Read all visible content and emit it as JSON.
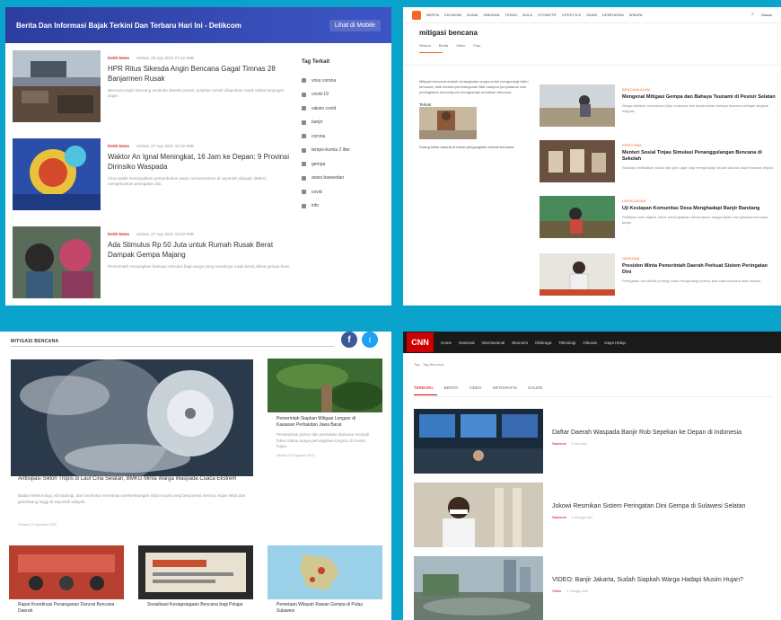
{
  "p1": {
    "header_title": "Berita Dan Informasi Bajak Terkini Dan Terbaru Hari Ini - Detikcom",
    "header_button": "Lihat di Mobile",
    "articles": [
      {
        "category": "Detik News",
        "date": "Selasa, 05 Agu 2021 07:42 WIB",
        "title": "HPR Ritus Sikesda Angin Bencana Gagal Timnas 28 Banjarmen Rusak",
        "excerpt": "Bencana angin kencang melanda daerah pesisir, puluhan rumah dilaporkan rusak akibat terjangan angin."
      },
      {
        "category": "Detik News",
        "date": "Selasa, 07 Agu 2021 10:19 WIB",
        "title": "Waktor An Ignal Meningkat, 16 Jam ke Depan: 9 Provinsi Dirinsiko Waspada",
        "excerpt": "Citra satelit menunjukkan pertumbuhan awan cumulonimbus di sejumlah wilayah, BMKG mengeluarkan peringatan dini."
      },
      {
        "category": "Detik News",
        "date": "Selasa, 07 Agu 2021 14:03 WIB",
        "title": "Ada Stimulus Rp 50 Juta untuk Rumah Rusak Berat Dampak Gempa Majang",
        "excerpt": "Pemerintah menyiapkan bantuan stimulus bagi warga yang rumahnya rusak berat akibat gempa bumi."
      }
    ],
    "side_title": "Tag Terkait",
    "tags": [
      "virus corona",
      "covid-19",
      "vaksin covid",
      "banjir",
      "corona",
      "tempo-kurnia 2 liter",
      "gempa",
      "anies baswedan",
      "covid",
      "info"
    ]
  },
  "p2": {
    "nav": [
      "BERITA",
      "EKONOMI",
      "DUNIA",
      "HIBURAN",
      "TEKNO",
      "BOLA",
      "OTOMOTIF",
      "LIFESTYLE",
      "SAINS",
      "KESEHATAN",
      "WISATA"
    ],
    "mask_label": "Masuk",
    "page_title": "mitigasi bencana",
    "subtabs": [
      "Semua",
      "Berita",
      "Video",
      "Foto"
    ],
    "intro": "Mitigasi bencana adalah serangkaian upaya untuk mengurangi risiko bencana, baik melalui pembangunan fisik maupun penyadaran dan peningkatan kemampuan menghadapi ancaman bencana.",
    "side_label": "Terkait",
    "small_text": "Ruang kelas darurat di lokasi pengungsian korban bencana",
    "articles": [
      {
        "category": "BENCANA ALAM",
        "title": "Mengenal Mitigasi Gempa dan Bahaya Tsunami di Pesisir Selatan",
        "excerpt": "Warga diimbau memahami jalur evakuasi dan tanda-tanda bahaya tsunami sebagai langkah mitigasi."
      },
      {
        "category": "PERISTIWA",
        "title": "Menteri Sosial Tinjau Simulasi Penanggulangan Bencana di Sekolah",
        "excerpt": "Simulasi melibatkan siswa dan guru agar siap menghadapi situasi darurat saat bencana terjadi."
      },
      {
        "category": "LINGKUNGAN",
        "title": "Uji Kesiapan Komunitas Desa Menghadapi Banjir Bandang",
        "excerpt": "Pelatihan rutin digelar untuk meningkatkan kemampuan warga dalam menghadapi bencana banjir."
      },
      {
        "category": "NASIONAL",
        "title": "Presiden Minta Pemerintah Daerah Perkuat Sistem Peringatan Dini",
        "excerpt": "Peringatan dini dinilai penting untuk mengurangi korban jiwa saat bencana alam terjadi."
      }
    ]
  },
  "p3": {
    "header": "MITIGASI BENCANA",
    "facebook_glyph": "f",
    "twitter_glyph": "t",
    "big_title": "Antisipasi Siklon Tropis di Laut Cina Selatan, BMKG Minta Warga Waspada Cuaca Ekstrem",
    "big_excerpt": "Badan Meteorologi, Klimatologi, dan Geofisika memantau perkembangan siklon tropis yang berpotensi memicu hujan lebat dan gelombang tinggi di sejumlah wilayah.",
    "big_date": "Selasa 07 Agustus 2021",
    "right_title": "Pemerintah Siapkan Mitigasi Longsor di Kawasan Perbukitan Jawa Barat",
    "right_excerpt": "Penanaman pohon dan perbaikan drainase menjadi fokus utama upaya pencegahan longsor di musim hujan.",
    "right_date": "Selasa 07 Agustus 2021",
    "bottom": [
      {
        "title": "Rapat Koordinasi Penanganan Darurat Bencana Daerah"
      },
      {
        "title": "Sosialisasi Kesiapsiagaan Bencana bagi Pelajar"
      },
      {
        "title": "Pemetaan Wilayah Rawan Gempa di Pulau Sulawesi"
      }
    ]
  },
  "p4": {
    "logo": "CNN",
    "nav": [
      "Home",
      "Nasional",
      "Internasional",
      "Ekonomi",
      "Olahraga",
      "Teknologi",
      "Hiburan",
      "Gaya Hidup"
    ],
    "crumb": "Tag · Tag Bencana",
    "tabs": [
      "TERBARU",
      "BERITA",
      "VIDEO",
      "INFOGRAFIS",
      "GALERI"
    ],
    "articles": [
      {
        "title": "Daftar Daerah Waspada Banjir Rob Sepekan ke Depan di Indonesia",
        "category": "Nasional",
        "date": "5 hari lalu"
      },
      {
        "title": "Jokowi Resmikan Sistem Peringatan Dini Gempa di Sulawesi Selatan",
        "category": "Nasional",
        "date": "1 minggu lalu"
      },
      {
        "title": "VIDEO: Banjir Jakarta, Sudah Siapkah Warga Hadapi Musim Hujan?",
        "category": "Video",
        "date": "2 minggu lalu"
      }
    ]
  },
  "colors": {
    "detik_blue": "#3d55c4",
    "kumparan_orange": "#f26a21",
    "cnn_red": "#cc0000",
    "frame": "#0aa3cc"
  }
}
